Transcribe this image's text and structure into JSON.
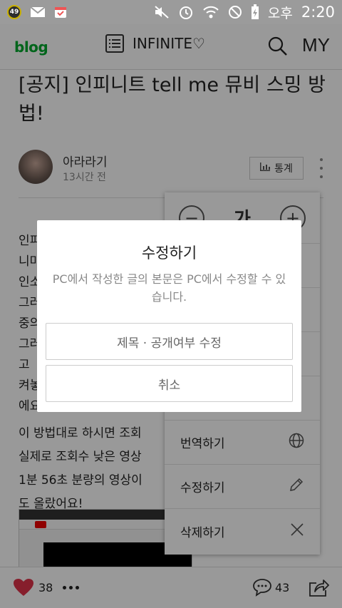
{
  "status_bar": {
    "notification_count": "49",
    "ampm": "오후",
    "time": "2:20"
  },
  "header": {
    "logo": "blog",
    "blog_title": "INFINITE♡",
    "my_label": "MY"
  },
  "post": {
    "title": "[공지] 인피니트 tell me 뮤비 스밍 방법!",
    "author": "아라라기",
    "time": "13시간 전",
    "stats_label": "통계",
    "body_lines": [
      "인피",
      "니마",
      "인소",
      "그러",
      "중의",
      "그러",
      "고 ",
      "켜놓",
      "에요."
    ],
    "body_lines_full": [
      "이 방법대로 하시면 조회",
      "실제로 조회수 낮은 영상",
      "1분 56초 분량의 영상이",
      "도 올랐어요!"
    ]
  },
  "side_menu": {
    "font_glyph": "가",
    "decrease": "−",
    "increase": "+",
    "items": [
      {
        "label": "번역하기",
        "icon": "globe-icon"
      },
      {
        "label": "수정하기",
        "icon": "pencil-icon"
      },
      {
        "label": "삭제하기",
        "icon": "close-icon"
      }
    ]
  },
  "bottom_bar": {
    "like_count": "38",
    "comment_count": "43"
  },
  "dialog": {
    "title": "수정하기",
    "message": "PC에서 작성한 글의 본문은 PC에서 수정할 수 있습니다.",
    "edit_button": "제목 · 공개여부 수정",
    "cancel_button": "취소"
  },
  "colors": {
    "logo_green": "#00a82d",
    "like_red": "#e0334a"
  }
}
